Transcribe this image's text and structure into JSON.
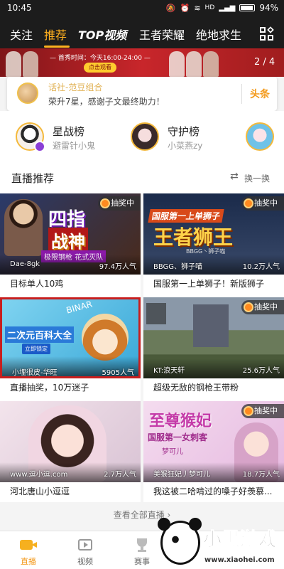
{
  "status": {
    "time": "10:45",
    "battery": "94%",
    "net": "HD"
  },
  "nav": {
    "tabs": [
      "关注",
      "推荐",
      "TOP视频",
      "王者荣耀",
      "绝地求生"
    ],
    "active": 1
  },
  "banner": {
    "text": "— 首秀时间：今天16:00-24:00 —",
    "button": "点击观看",
    "page": "2 / 4"
  },
  "notice": {
    "title": "话社-范豆组合",
    "sub": "荣升7星，感谢子文最终助力！",
    "tag": "头条"
  },
  "ranks": [
    {
      "title": "星战榜",
      "sub": "避雷针小鬼"
    },
    {
      "title": "守护榜",
      "sub": "小菜燕zy"
    }
  ],
  "section": {
    "title": "直播推荐",
    "refresh": "换一换"
  },
  "lottery_label": "抽奖中",
  "cards": [
    {
      "streamer": "Dae-8gk",
      "pop": "97.4万人气",
      "caption": "目标单人10鸡",
      "lottery": true,
      "overlay1": "四指",
      "overlay2": "战神",
      "overlay3": "极限钢枪 花式灭队"
    },
    {
      "streamer": "BBGG、狮子喵",
      "pop": "10.2万人气",
      "caption": "国服第一上单狮子！新版狮子",
      "lottery": true,
      "overlay1": "国服第一上单狮子",
      "overlay2": "王者狮王",
      "overlay3": "BBGG丶狮子喵"
    },
    {
      "streamer": "小埋很皮-华旺",
      "pop": "5905人气",
      "caption": "直播抽奖，10万迷子",
      "lottery": false,
      "overlay1": "二次元百科大全",
      "overlay2": "立即锁定",
      "overlay3": "BINAR"
    },
    {
      "streamer": "KT:浪天轩",
      "pop": "25.6万人气",
      "caption": "超级无敌的钢枪王带粉",
      "lottery": true
    },
    {
      "streamer": "www.逗小逗.com",
      "pop": "2.7万人气",
      "caption": "河北唐山小逗逗",
      "lottery": false
    },
    {
      "streamer": "美猴狂妃丿梦可儿",
      "pop": "18.7万人气",
      "caption": "我这被二哈啃过的嗓子好羡慕...",
      "lottery": true,
      "overlay1": "至尊猴妃",
      "overlay2": "国服第一女刺客",
      "overlay3": "梦可儿"
    }
  ],
  "more": "查看全部直播  ›",
  "tabbar": [
    {
      "label": "直播",
      "active": true
    },
    {
      "label": "视频",
      "active": false
    },
    {
      "label": "赛事",
      "active": false
    },
    {
      "label": "",
      "active": false
    },
    {
      "label": "",
      "active": false
    }
  ],
  "watermark": {
    "cn": "小黑游戏",
    "url": "www.xiaohei.com"
  },
  "colors": {
    "accent": "#ffb01f",
    "highlight": "#c81e1e"
  }
}
